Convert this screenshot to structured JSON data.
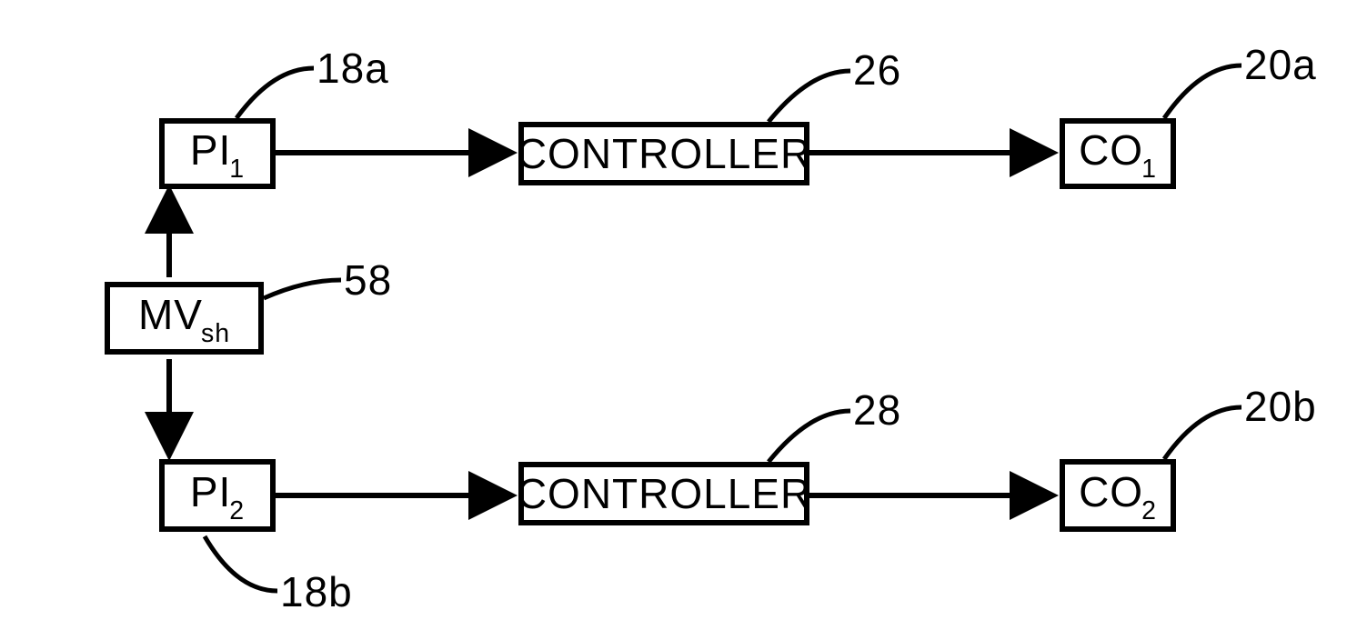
{
  "blocks": {
    "pi1": {
      "base": "PI",
      "sub": "1",
      "ref": "18a"
    },
    "pi2": {
      "base": "PI",
      "sub": "2",
      "ref": "18b"
    },
    "mvsh": {
      "base": "MV",
      "sub": "sh",
      "ref": "58"
    },
    "controller1": {
      "label": "CONTROLLER",
      "ref": "26"
    },
    "controller2": {
      "label": "CONTROLLER",
      "ref": "28"
    },
    "co1": {
      "base": "CO",
      "sub": "1",
      "ref": "20a"
    },
    "co2": {
      "base": "CO",
      "sub": "2",
      "ref": "20b"
    }
  },
  "chart_data": {
    "type": "diagram-block",
    "nodes": [
      {
        "id": "18a",
        "label": "PI_1"
      },
      {
        "id": "18b",
        "label": "PI_2"
      },
      {
        "id": "58",
        "label": "MV_sh"
      },
      {
        "id": "26",
        "label": "CONTROLLER"
      },
      {
        "id": "28",
        "label": "CONTROLLER"
      },
      {
        "id": "20a",
        "label": "CO_1"
      },
      {
        "id": "20b",
        "label": "CO_2"
      }
    ],
    "edges": [
      {
        "from": "58",
        "to": "18a"
      },
      {
        "from": "58",
        "to": "18b"
      },
      {
        "from": "18a",
        "to": "26"
      },
      {
        "from": "26",
        "to": "20a"
      },
      {
        "from": "18b",
        "to": "28"
      },
      {
        "from": "28",
        "to": "20b"
      }
    ]
  }
}
